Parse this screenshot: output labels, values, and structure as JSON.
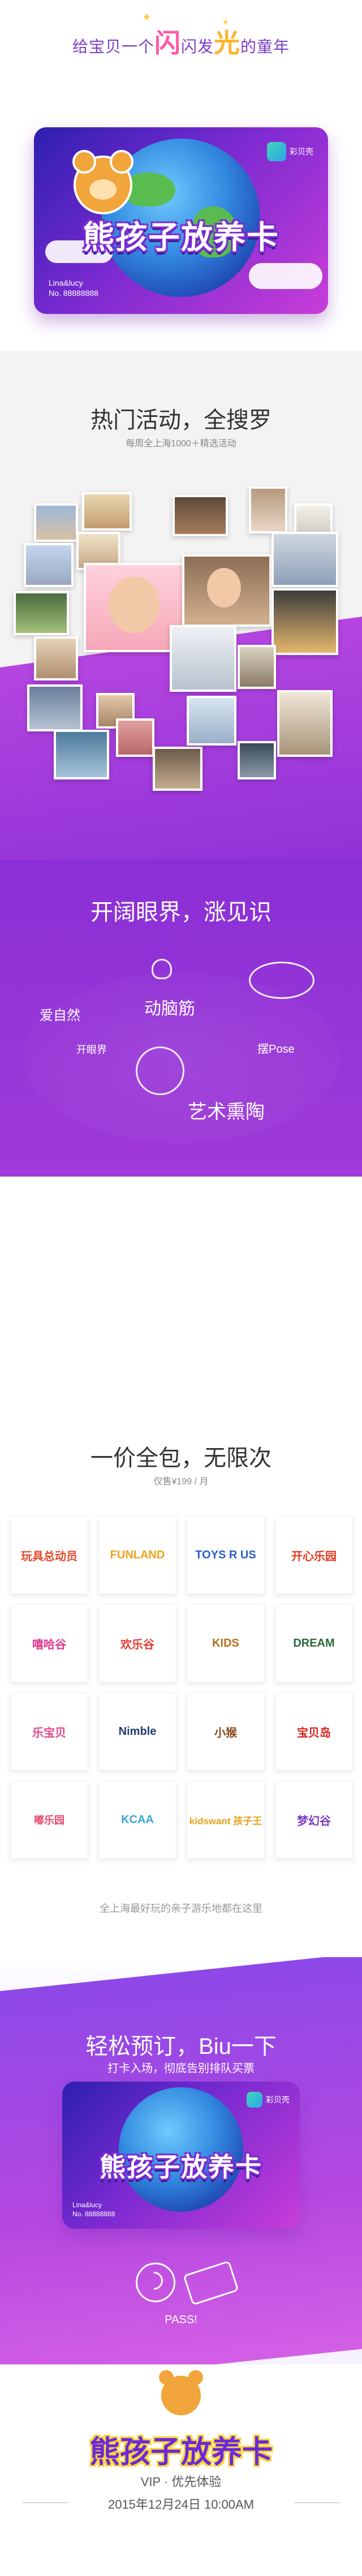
{
  "header": {
    "slogan_prefix": "给宝贝一个",
    "slogan_big": "闪",
    "slogan_mid": "闪发",
    "slogan_big2": "光",
    "slogan_suffix": "的童年"
  },
  "card": {
    "title": "熊孩子放养卡",
    "brand": "彩贝壳",
    "owner_name": "Lina&lucy",
    "owner_no": "No. 88888888"
  },
  "hot": {
    "title": "热门活动，全搜罗",
    "subtitle": "每周全上海1000＋精选活动"
  },
  "broad": {
    "title": "开阔眼界，涨见识",
    "tags": [
      "爱自然",
      "动脑筋",
      "开眼界",
      "摆Pose",
      "艺术熏陶"
    ]
  },
  "pack": {
    "title": "一价全包，无限次",
    "subtitle": "仅售¥199 / 月",
    "logos": [
      "玩具总动员",
      "FUNLAND",
      "TOYS R US",
      "开心乐园",
      "嘻哈谷",
      "欢乐谷",
      "KIDS",
      "DREAM",
      "乐宝贝",
      "Nimble",
      "小猴",
      "宝贝岛",
      "嘟乐园",
      "KCAA",
      "kidswant 孩子王",
      "梦幻谷"
    ],
    "note": "全上海最好玩的亲子游乐地都在这里"
  },
  "book": {
    "title": "轻松预订，Biu一下",
    "subtitle": "打卡入场，彻底告别排队买票",
    "pass": "PASS!"
  },
  "footer": {
    "logo": "熊孩子放养卡",
    "tagline": "VIP · 优先体验",
    "time": "2015年12月24日   10:00AM"
  },
  "colors": {
    "purple": "#8a2fd6",
    "pink": "#ff5aa8",
    "yellow": "#ffcf3d"
  }
}
